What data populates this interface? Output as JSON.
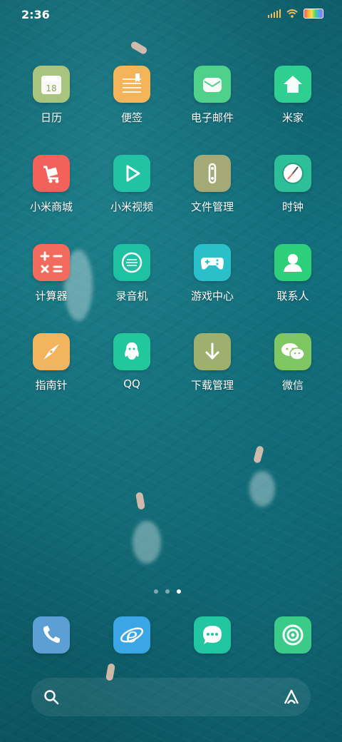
{
  "status_bar": {
    "time": "2:36"
  },
  "apps": [
    {
      "label": "日历",
      "icon": "calendar-icon",
      "color": "#a8c47e",
      "glyph": "18"
    },
    {
      "label": "便签",
      "icon": "notes-icon",
      "color": "#f3b45a",
      "glyph": ""
    },
    {
      "label": "电子邮件",
      "icon": "email-icon",
      "color": "#4fd18b",
      "glyph": ""
    },
    {
      "label": "米家",
      "icon": "home-icon",
      "color": "#2ecf91",
      "glyph": ""
    },
    {
      "label": "小米商城",
      "icon": "cart-icon",
      "color": "#f2625b",
      "glyph": ""
    },
    {
      "label": "小米视频",
      "icon": "play-icon",
      "color": "#22c2a4",
      "glyph": ""
    },
    {
      "label": "文件管理",
      "icon": "folder-icon",
      "color": "#a3a977",
      "glyph": ""
    },
    {
      "label": "时钟",
      "icon": "clock-icon",
      "color": "#2dbf97",
      "glyph": ""
    },
    {
      "label": "计算器",
      "icon": "calculator-icon",
      "color": "#f26b5c",
      "glyph": ""
    },
    {
      "label": "录音机",
      "icon": "recorder-icon",
      "color": "#1fc1a3",
      "glyph": ""
    },
    {
      "label": "游戏中心",
      "icon": "gamepad-icon",
      "color": "#2bbfc9",
      "glyph": ""
    },
    {
      "label": "联系人",
      "icon": "contact-icon",
      "color": "#2ecf7a",
      "glyph": ""
    },
    {
      "label": "指南针",
      "icon": "compass-icon",
      "color": "#f3b460",
      "glyph": ""
    },
    {
      "label": "QQ",
      "icon": "qq-icon",
      "color": "#22c79b",
      "glyph": ""
    },
    {
      "label": "下载管理",
      "icon": "download-icon",
      "color": "#9fb06e",
      "glyph": ""
    },
    {
      "label": "微信",
      "icon": "wechat-icon",
      "color": "#7fc763",
      "glyph": ""
    }
  ],
  "dock": [
    {
      "icon": "phone-icon",
      "color": "#5b9fd4"
    },
    {
      "icon": "browser-icon",
      "color": "#3aa6e6"
    },
    {
      "icon": "messages-icon",
      "color": "#21c6a0"
    },
    {
      "icon": "camera-icon",
      "color": "#3bcb88"
    }
  ],
  "page_indicator": {
    "count": 3,
    "active": 3
  }
}
